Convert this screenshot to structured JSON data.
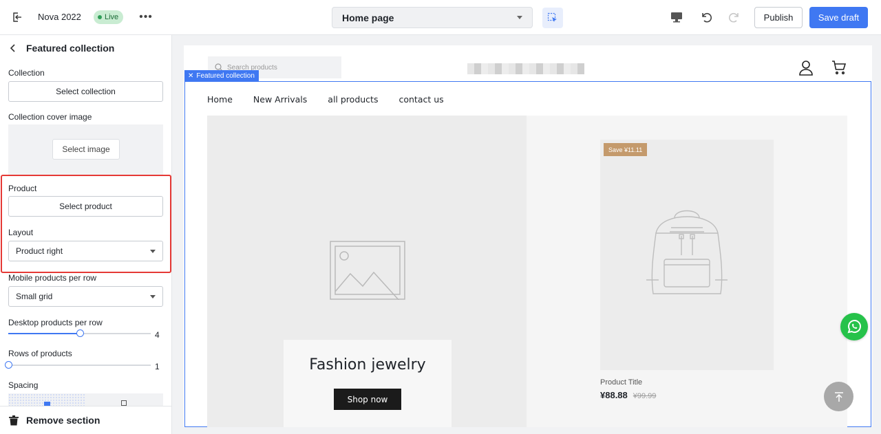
{
  "topbar": {
    "store_name": "Nova 2022",
    "live_label": "Live",
    "more_label": "•••",
    "page_select": "Home page",
    "publish_label": "Publish",
    "save_draft_label": "Save draft"
  },
  "sidebar": {
    "title": "Featured collection",
    "collection_label": "Collection",
    "select_collection": "Select collection",
    "cover_label": "Collection cover image",
    "select_image": "Select image",
    "product_label": "Product",
    "select_product": "Select product",
    "layout_label": "Layout",
    "layout_value": "Product right",
    "mobile_label": "Mobile products per row",
    "mobile_value": "Small grid",
    "desktop_label": "Desktop products per row",
    "desktop_value": "4",
    "desktop_fraction": 0.5,
    "rows_label": "Rows of products",
    "rows_value": "1",
    "rows_fraction": 0,
    "spacing_label": "Spacing",
    "remove_label": "Remove section"
  },
  "preview": {
    "search_placeholder": "Search products",
    "section_tag": "Featured collection",
    "nav": [
      "Home",
      "New Arrivals",
      "all products",
      "contact us"
    ],
    "promo_title": "Fashion jewelry",
    "shop_now": "Shop now",
    "save_badge": "Save ¥11.11",
    "product_title": "Product Title",
    "price_now": "¥88.88",
    "price_was": "¥99.99"
  },
  "colors": {
    "accent": "#3f78f2",
    "highlight": "#e53935",
    "live_badge": "#c9ecd2",
    "badge": "#c49a6c",
    "whatsapp": "#26c24a"
  }
}
